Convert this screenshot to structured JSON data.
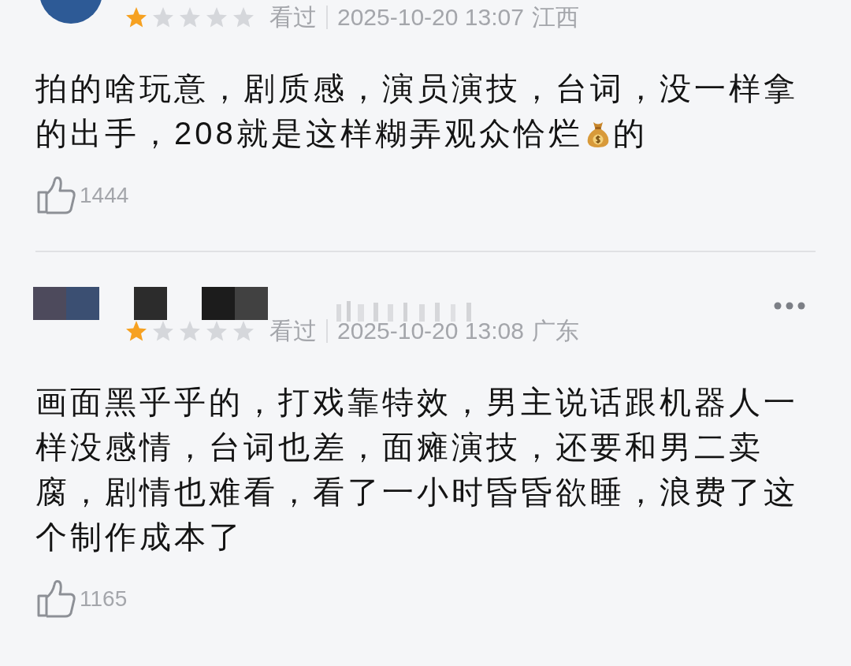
{
  "reviews": [
    {
      "stars": 1,
      "status": "看过",
      "time": "2025-10-20 13:07",
      "region": "江西",
      "masked": false,
      "body_segments": [
        {
          "kind": "text",
          "text": "拍的啥玩意，剧质感，演员演技，台词，没一样拿的出手，208就是这样糊弄观众恰烂"
        },
        {
          "kind": "money-bag"
        },
        {
          "kind": "text",
          "text": "的"
        }
      ],
      "likes": "1444",
      "more": false,
      "cut": true
    },
    {
      "stars": 1,
      "status": "看过",
      "time": "2025-10-20 13:08",
      "region": "广东",
      "masked": true,
      "body_segments": [
        {
          "kind": "text",
          "text": "画面黑乎乎的，打戏靠特效，男主说话跟机器人一样没感情，台词也差，面瘫演技，还要和男二卖腐，剧情也难看，看了一小时昏昏欲睡，浪费了这个制作成本了"
        }
      ],
      "likes": "1165",
      "more": true,
      "cut": false
    }
  ]
}
